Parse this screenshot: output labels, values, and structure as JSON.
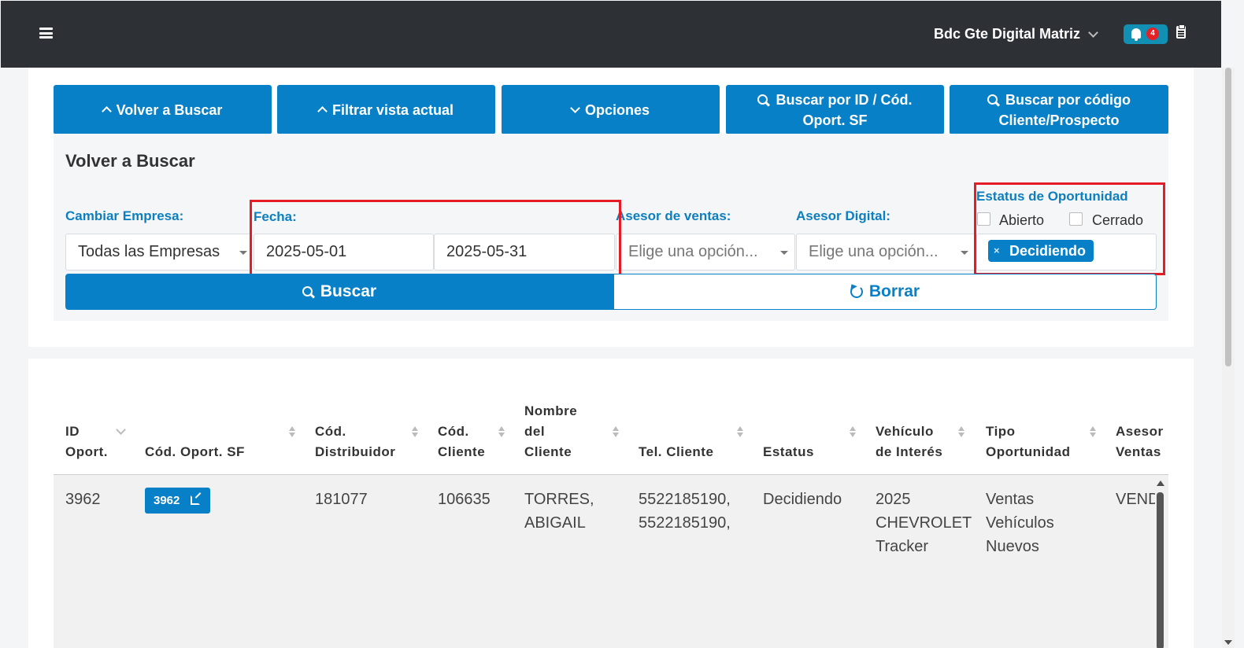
{
  "header": {
    "user_name": "Bdc Gte Digital Matriz",
    "notification_count": "4"
  },
  "toolbar": {
    "back_label": "Volver a Buscar",
    "filter_label": "Filtrar vista actual",
    "options_label": "Opciones",
    "search_id_line1": "Buscar por ID / Cód.",
    "search_id_line2": "Oport. SF",
    "search_client_line1": "Buscar por código",
    "search_client_line2": "Cliente/Prospecto"
  },
  "search": {
    "title": "Volver a Buscar",
    "company_label": "Cambiar Empresa:",
    "company_value": "Todas las Empresas",
    "date_label": "Fecha:",
    "date_from": "2025-05-01",
    "date_to": "2025-05-31",
    "sales_advisor_label": "Asesor de ventas:",
    "sales_advisor_placeholder": "Elige una opción...",
    "digital_advisor_label": "Asesor Digital:",
    "digital_advisor_placeholder": "Elige una opción...",
    "status_label": "Estatus de Oportunidad",
    "status_open": "Abierto",
    "status_closed": "Cerrado",
    "status_chip": "Decidiendo",
    "chip_remove": "×",
    "search_button": "Buscar",
    "clear_button": "Borrar"
  },
  "table": {
    "headers": {
      "id_1": "ID",
      "id_2": "Oport.",
      "sf": "Cód. Oport. SF",
      "dist_1": "Cód.",
      "dist_2": "Distribuidor",
      "client_code_1": "Cód.",
      "client_code_2": "Cliente",
      "name_1": "Nombre",
      "name_2": "del",
      "name_3": "Cliente",
      "tel": "Tel. Cliente",
      "status": "Estatus",
      "vehicle_1": "Vehículo",
      "vehicle_2": "de Interés",
      "type_1": "Tipo",
      "type_2": "Oportunidad",
      "advisor_1": "Asesor",
      "advisor_2": "Ventas"
    },
    "rows": [
      {
        "id": "3962",
        "sf_code": "3962",
        "distributor": "181077",
        "client_code": "106635",
        "name_1": "TORRES,",
        "name_2": "ABIGAIL",
        "tel_1": "5522185190,",
        "tel_2": "5522185190,",
        "status": "Decidiendo",
        "vehicle_1": "2025",
        "vehicle_2": "CHEVROLET",
        "vehicle_3": "Tracker",
        "type_1": "Ventas",
        "type_2": "Vehículos",
        "type_3": "Nuevos",
        "advisor": "VENDE"
      }
    ]
  },
  "colors": {
    "primary": "#0880c7",
    "topbar": "#2d3035",
    "highlight": "#e41c25",
    "label": "#0d7fbf"
  }
}
